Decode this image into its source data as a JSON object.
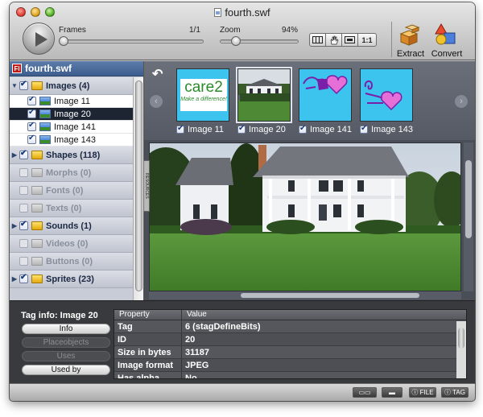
{
  "window": {
    "title": "fourth.swf"
  },
  "toolbar": {
    "frames_label": "Frames",
    "frames_value": "1/1",
    "zoom_label": "Zoom",
    "zoom_value": "94%",
    "zoom_level": 0.94,
    "one_to_one": "1:1",
    "extract_label": "Extract",
    "convert_label": "Convert"
  },
  "sidebar": {
    "file_badge": "Fl",
    "file_name": "fourth.swf",
    "resources_tab": "RESOURCES",
    "categories": [
      {
        "label": "Images (4)",
        "expanded": true,
        "enabled": true
      },
      {
        "label": "Shapes (118)",
        "expanded": false,
        "enabled": true
      },
      {
        "label": "Morphs (0)",
        "expanded": false,
        "enabled": false
      },
      {
        "label": "Fonts (0)",
        "expanded": false,
        "enabled": false
      },
      {
        "label": "Texts (0)",
        "expanded": false,
        "enabled": false
      },
      {
        "label": "Sounds (1)",
        "expanded": false,
        "enabled": true
      },
      {
        "label": "Videos (0)",
        "expanded": false,
        "enabled": false
      },
      {
        "label": "Buttons (0)",
        "expanded": false,
        "enabled": false
      },
      {
        "label": "Sprites (23)",
        "expanded": false,
        "enabled": true
      }
    ],
    "images": [
      "Image 11",
      "Image 20",
      "Image 141",
      "Image 143"
    ],
    "selected_image": "Image 20"
  },
  "thumbnails": [
    {
      "label": "Image 11",
      "logo_text": "care2",
      "tagline": "Make a difference!"
    },
    {
      "label": "Image 20"
    },
    {
      "label": "Image 141"
    },
    {
      "label": "Image 143"
    }
  ],
  "info_panel": {
    "title": "Tag info: Image 20",
    "buttons": [
      "Info",
      "Placeobjects",
      "Uses",
      "Used by"
    ],
    "columns": [
      "Property",
      "Value"
    ],
    "rows": [
      {
        "property": "Tag",
        "value": "6 (stagDefineBits)"
      },
      {
        "property": "ID",
        "value": "20"
      },
      {
        "property": "Size in bytes",
        "value": "31187"
      },
      {
        "property": "Image format",
        "value": "JPEG"
      },
      {
        "property": "Has alpha",
        "value": "No"
      }
    ]
  },
  "statusbar": {
    "file_label": "FILE",
    "tag_label": "TAG"
  },
  "colors": {
    "accent": "#3c5d8e",
    "thumb_bg": "#3cc3ee",
    "selected_row": "#1d2432",
    "heart": "#e56fd6",
    "ribbon": "#7a1fa8"
  }
}
